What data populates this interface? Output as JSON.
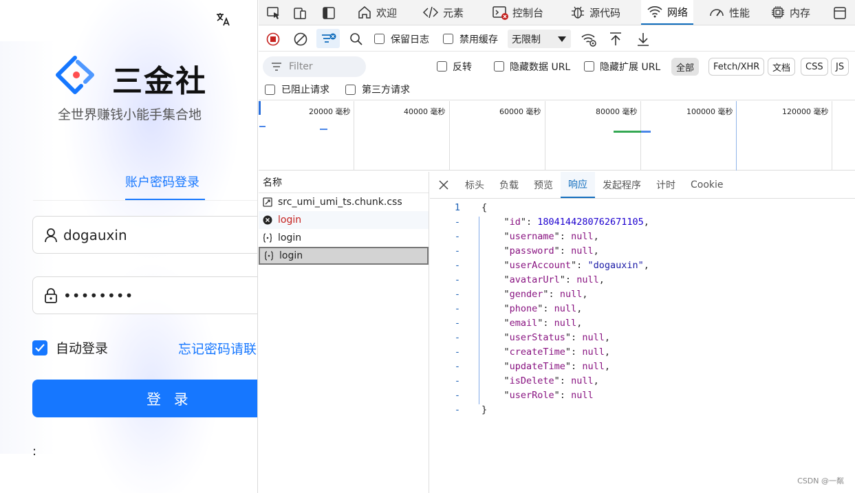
{
  "login": {
    "translate_icon": "translate-icon",
    "app_title": "三金社",
    "app_subtitle": "全世界赚钱小能手集合地",
    "tab_label": "账户密码登录",
    "username_value": "dogauxin",
    "password_value": "••••••••",
    "remember_label": "自动登录",
    "forgot_label": "忘记密码请联",
    "login_button": "登 录",
    "colon_text": ":",
    "accent_color": "#1677ff"
  },
  "devtools": {
    "tabs": [
      "欢迎",
      "元素",
      "控制台",
      "源代码",
      "网络",
      "性能",
      "内存"
    ],
    "active_tab": "网络",
    "toolbar": {
      "preserve_log": "保留日志",
      "disable_cache": "禁用缓存",
      "throttle": "无限制"
    },
    "filter": {
      "placeholder": "Filter",
      "invert": "反转",
      "hide_data_url": "隐藏数据 URL",
      "hide_ext_url": "隐藏扩展 URL",
      "types": [
        "全部",
        "Fetch/XHR",
        "文档",
        "CSS",
        "JS"
      ],
      "blocked_requests": "已阻止请求",
      "third_party": "第三方请求"
    },
    "timeline": {
      "ticks": [
        "20000 毫秒",
        "40000 毫秒",
        "60000 毫秒",
        "80000 毫秒",
        "100000 毫秒",
        "120000 毫秒"
      ]
    },
    "requests": {
      "header": "名称",
      "items": [
        {
          "name": "src_umi_umi_ts.chunk.css",
          "status": "ok"
        },
        {
          "name": "login",
          "status": "error"
        },
        {
          "name": "login",
          "status": "ok"
        },
        {
          "name": "login",
          "status": "selected"
        }
      ]
    },
    "response_tabs": [
      "标头",
      "负载",
      "预览",
      "响应",
      "发起程序",
      "计时",
      "Cookie"
    ],
    "active_response_tab": "响应",
    "response_json": {
      "id": "1804144280762671105",
      "username": "null",
      "password": "null",
      "userAccount": "\"dogauxin\"",
      "avatarUrl": "null",
      "gender": "null",
      "phone": "null",
      "email": "null",
      "userStatus": "null",
      "createTime": "null",
      "updateTime": "null",
      "isDelete": "null",
      "userRole": "null"
    },
    "watermark": "CSDN @一粼"
  }
}
